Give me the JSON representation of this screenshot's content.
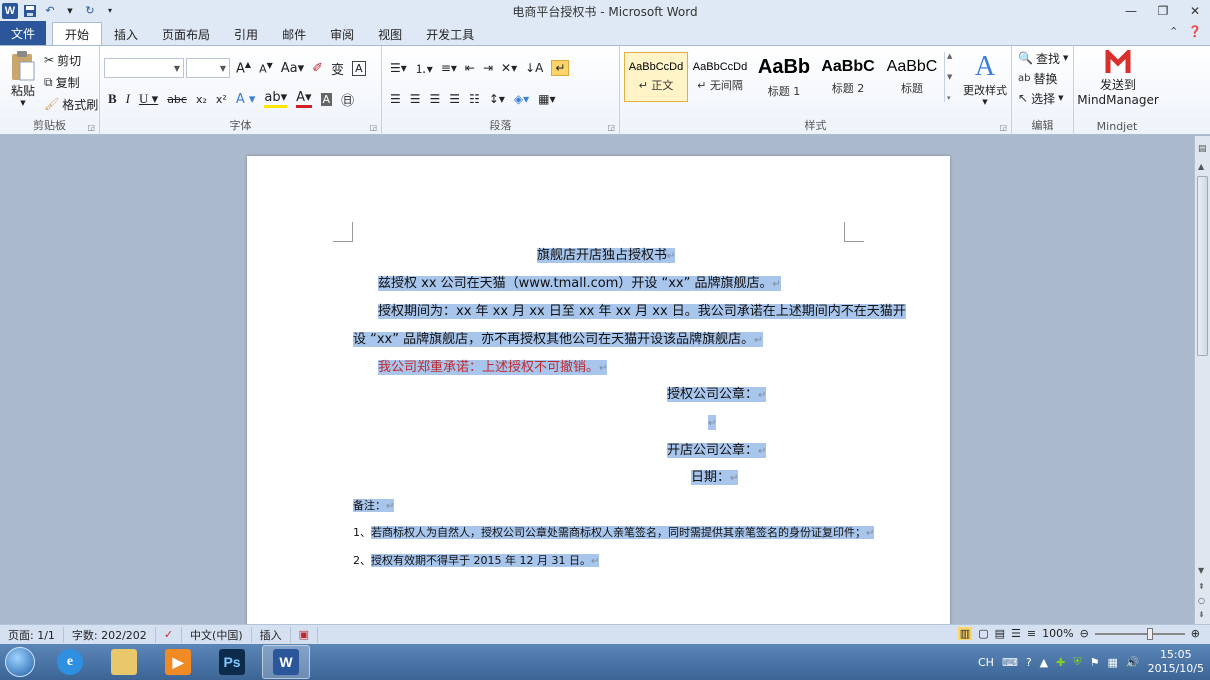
{
  "window": {
    "title": "电商平台授权书 - Microsoft Word"
  },
  "tabs": [
    "文件",
    "开始",
    "插入",
    "页面布局",
    "引用",
    "邮件",
    "审阅",
    "视图",
    "开发工具"
  ],
  "clipboard": {
    "paste": "粘贴",
    "cut": "剪切",
    "copy": "复制",
    "format_painter": "格式刷",
    "group": "剪贴板"
  },
  "font": {
    "group": "字体",
    "name": "",
    "size": ""
  },
  "paragraph": {
    "group": "段落"
  },
  "styles": {
    "group": "样式",
    "items": [
      {
        "sample": "AaBbCcDd",
        "name": "↵ 正文"
      },
      {
        "sample": "AaBbCcDd",
        "name": "↵ 无间隔"
      },
      {
        "sample": "AaBb",
        "name": "标题 1"
      },
      {
        "sample": "AaBbC",
        "name": "标题 2"
      },
      {
        "sample": "AaBbC",
        "name": "标题"
      }
    ],
    "change": "更改样式"
  },
  "editing": {
    "group": "编辑",
    "find": "查找",
    "replace": "替换",
    "select": "选择"
  },
  "mindjet": {
    "group": "Mindjet",
    "send1": "发送到",
    "send2": "MindManager"
  },
  "document": {
    "title": "旗舰店开店独占授权书",
    "p1": "兹授权 xx 公司在天猫（www.tmall.com）开设 “xx” 品牌旗舰店。",
    "p2a": "授权期间为：xx 年 xx 月 xx 日至 xx 年 xx 月 xx 日。我公司承诺在上述期间内不在天猫开",
    "p2b": "设 “xx” 品牌旗舰店，亦不再授权其他公司在天猫开设该品牌旗舰店。",
    "p3": "我公司郑重承诺：上述授权不可撤销。",
    "seal1": "授权公司公章：",
    "seal2": "开店公司公章：",
    "date": "日期：",
    "note": "备注：",
    "n1_num": "1、",
    "n1": "若商标权人为自然人，授权公司公章处需商标权人亲笔签名，同时需提供其亲笔签名的身份证复印件；",
    "n2_num": "2、",
    "n2": "授权有效期不得早于 2015 年 12 月 31 日。",
    "mark": "↵"
  },
  "status": {
    "page": "页面: 1/1",
    "words": "字数: 202/202",
    "lang": "中文(中国)",
    "mode": "插入",
    "zoom": "100%"
  },
  "taskbar": {
    "lang": "CH",
    "time": "15:05",
    "date": "2015/10/5"
  }
}
